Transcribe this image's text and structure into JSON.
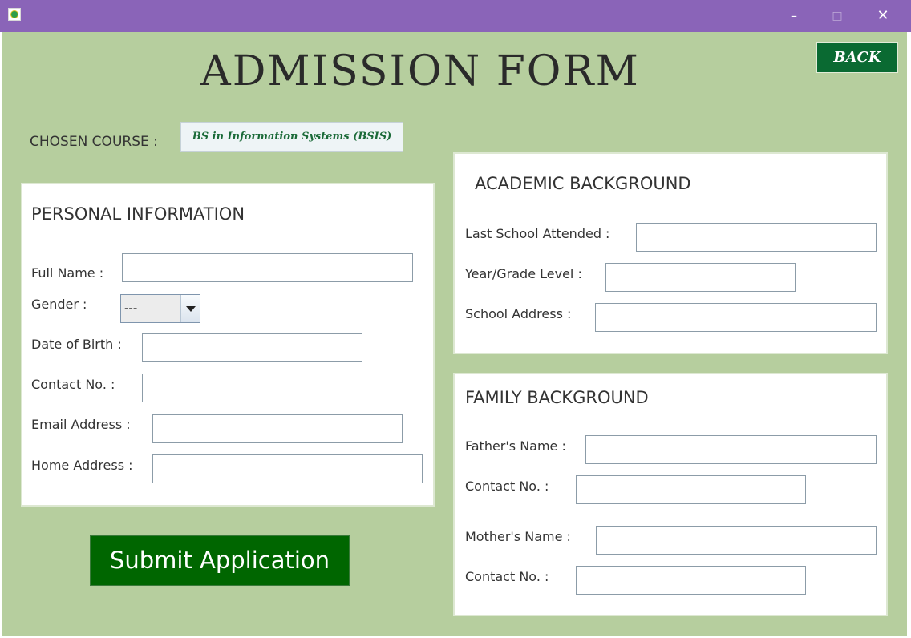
{
  "window": {
    "minimize_label": "–",
    "maximize_label": "□",
    "close_label": "✕"
  },
  "header": {
    "title": "ADMISSION FORM",
    "back_label": "BACK"
  },
  "course": {
    "label": "CHOSEN COURSE :",
    "value": "BS in Information Systems (BSIS)"
  },
  "personal": {
    "title": "PERSONAL INFORMATION",
    "full_name_label": "Full Name :",
    "gender_label": "Gender :",
    "gender_value": "---",
    "dob_label": "Date of Birth :",
    "contact_label": "Contact No. :",
    "email_label": "Email Address :",
    "home_address_label": "Home Address :"
  },
  "academic": {
    "title": "ACADEMIC BACKGROUND",
    "last_school_label": "Last School Attended :",
    "year_level_label": "Year/Grade Level :",
    "school_address_label": "School Address :"
  },
  "family": {
    "title": "FAMILY BACKGROUND",
    "father_name_label": "Father's Name :",
    "father_contact_label": "Contact No. :",
    "mother_name_label": "Mother's Name :",
    "mother_contact_label": "Contact No. :"
  },
  "submit_label": "Submit Application",
  "icons": {
    "app": "app-logo-icon",
    "dropdown": "chevron-down-icon"
  },
  "colors": {
    "title_bar": "#8a64b8",
    "background": "#b6ce9e",
    "button_green": "#006600",
    "back_green": "#0a6a32",
    "course_text": "#1a6a38"
  }
}
